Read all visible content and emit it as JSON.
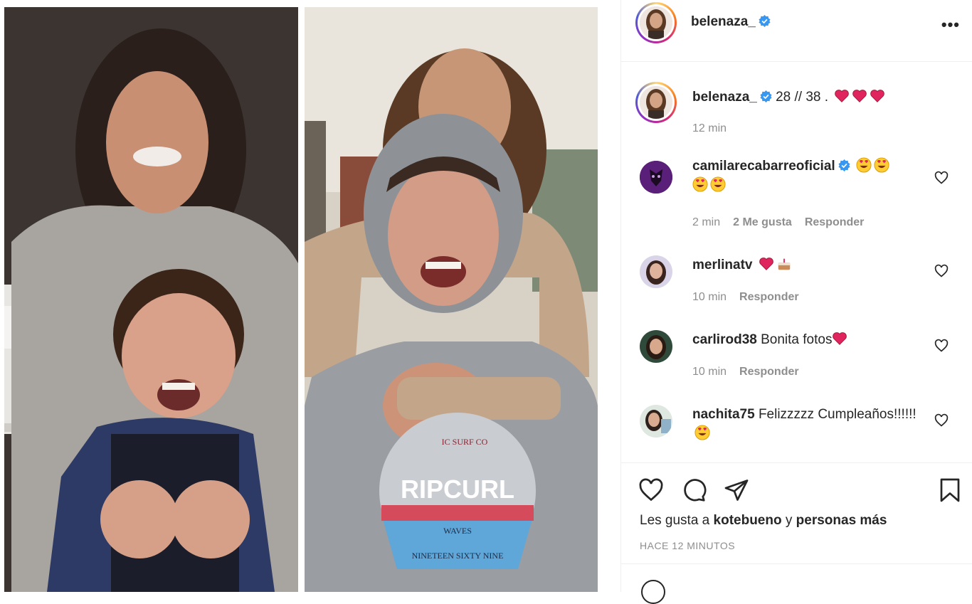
{
  "post": {
    "author": "belenaza_",
    "more_label": "•••",
    "photos": [
      {
        "name": "photo-then"
      },
      {
        "name": "photo-now"
      }
    ],
    "hoodie_text": "RIPCURL",
    "hoodie_sub": "WAVES",
    "hoodie_arc": "NINETEEN SIXTY NINE",
    "hoodie_top": "IC SURF CO"
  },
  "caption": {
    "user": "belenaza_",
    "text": " 28 // 38 . ",
    "time": "12 min"
  },
  "comments": [
    {
      "user": "camilarecabarreoficial",
      "verified": true,
      "text": "",
      "time": "2 min",
      "likes": "2 Me gusta",
      "reply": "Responder"
    },
    {
      "user": "merlinatv",
      "verified": false,
      "text": "",
      "time": "10 min",
      "reply": "Responder"
    },
    {
      "user": "carlirod38",
      "verified": false,
      "text": "Bonita fotos",
      "time": "10 min",
      "reply": "Responder"
    },
    {
      "user": "nachita75",
      "verified": false,
      "text": "Felizzzzz Cumpleaños!!!!!!",
      "time": ""
    }
  ],
  "likes": {
    "prefix": "Les gusta a ",
    "user": "kotebueno",
    "middle": " y ",
    "rest": "personas más"
  },
  "timestamp": "HACE 12 MINUTOS",
  "colors": {
    "verified": "#3897f0",
    "heart_red": "#ed4956",
    "muted": "#8e8e8e",
    "text": "#262626",
    "border": "#efefef"
  },
  "icons": [
    "heart-icon",
    "comment-icon",
    "share-icon",
    "bookmark-icon",
    "more-icon",
    "verified-icon"
  ]
}
